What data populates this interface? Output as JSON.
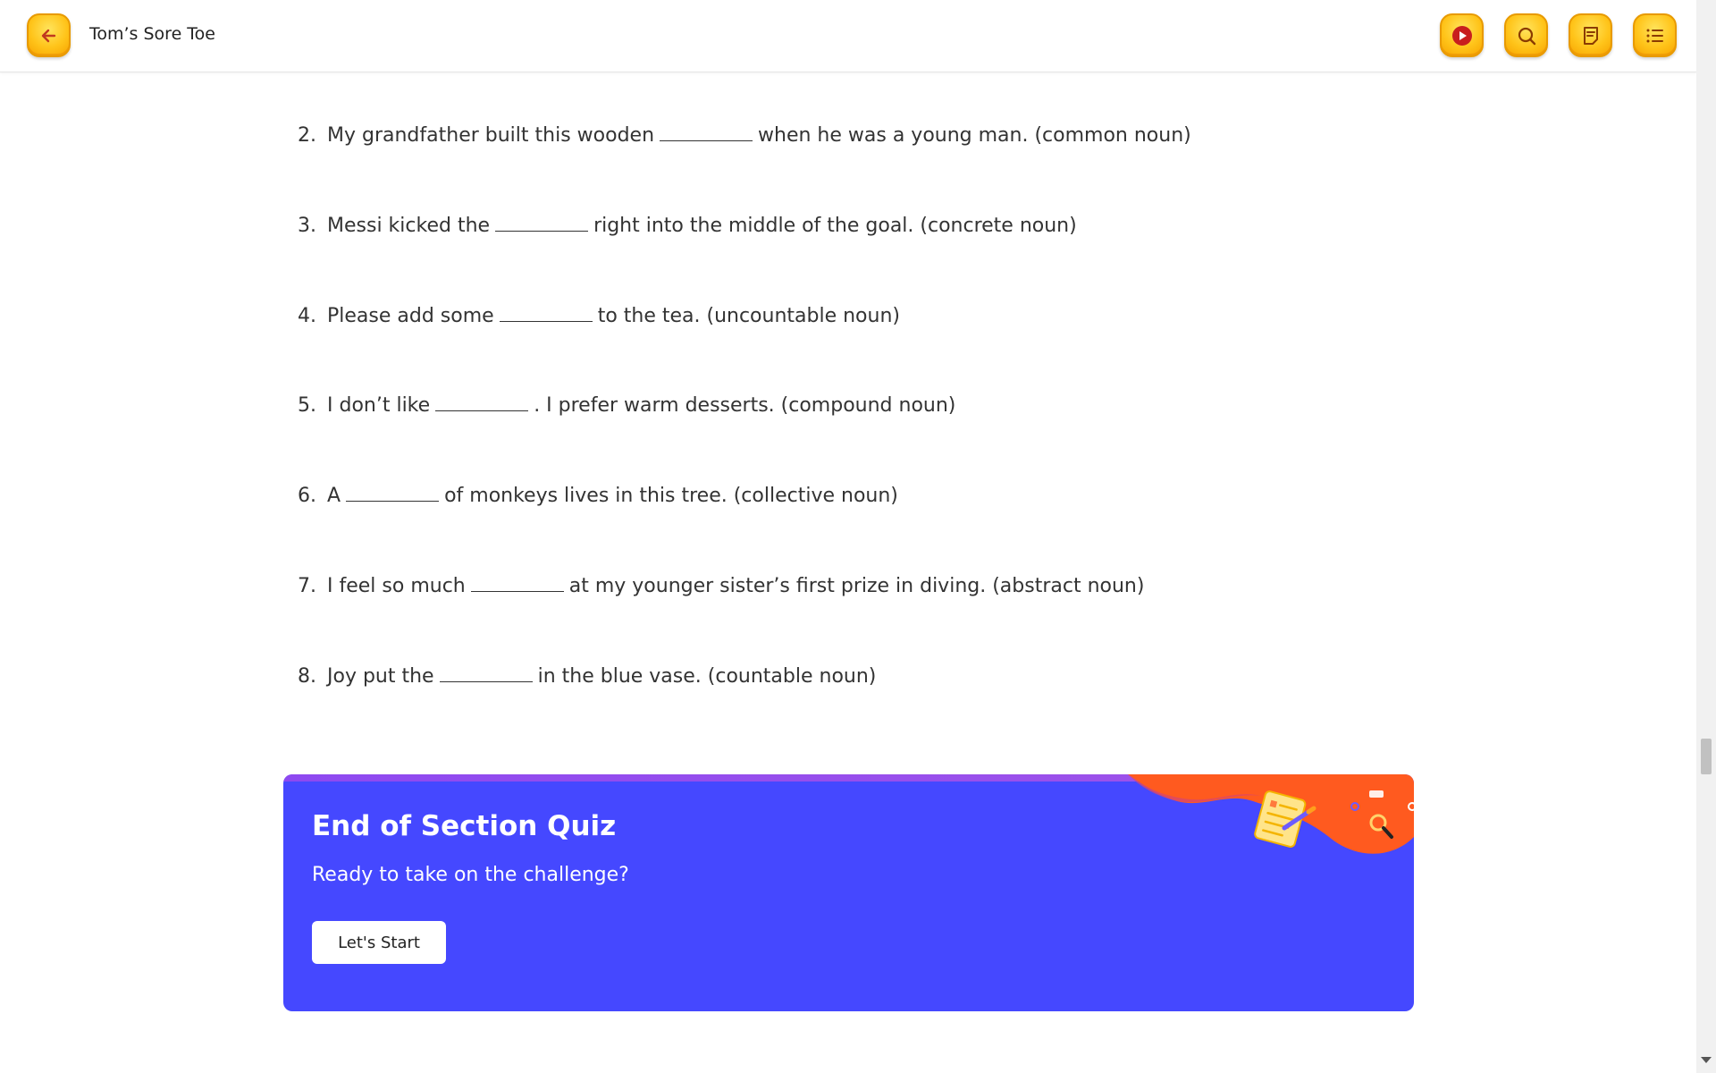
{
  "header": {
    "title": "Tom’s Sore Toe",
    "icons": {
      "back": "arrow-left-icon",
      "play": "play-icon",
      "search": "search-icon",
      "notes": "notes-icon",
      "menu": "list-menu-icon"
    },
    "accent_color": "#ffc41a"
  },
  "exercise": {
    "items": [
      {
        "num": "2.",
        "before": "My grandfather built this wooden",
        "after": "when he was a young man. (common noun)"
      },
      {
        "num": "3.",
        "before": "Messi kicked the",
        "after": "right into the middle of the goal. (concrete noun)"
      },
      {
        "num": "4.",
        "before": "Please add some",
        "after": "to the tea. (uncountable noun)"
      },
      {
        "num": "5.",
        "before": "I don’t like",
        "after": ". I prefer warm desserts. (compound noun)"
      },
      {
        "num": "6.",
        "before": "A",
        "after": "of monkeys lives in this tree. (collective noun)"
      },
      {
        "num": "7.",
        "before": "I feel so much",
        "after": "at my younger sister’s first prize in diving. (abstract noun)"
      },
      {
        "num": "8.",
        "before": "Joy put the",
        "after": "in the blue vase. (countable noun)"
      }
    ]
  },
  "quiz": {
    "title": "End of Section Quiz",
    "subtitle": "Ready to take on the challenge?",
    "button_label": "Let's Start",
    "background_color": "#4548ff",
    "art_icon": "quiz-checklist-illustration"
  }
}
